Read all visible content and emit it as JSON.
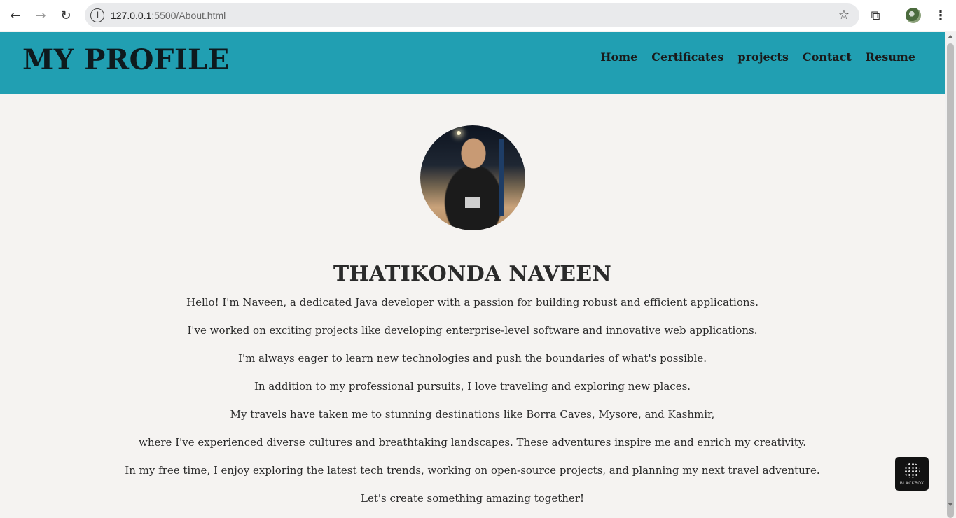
{
  "browser": {
    "url_host": "127.0.0.1",
    "url_path": ":5500/About.html",
    "back_icon": "arrow-left-icon",
    "forward_icon": "arrow-right-icon",
    "reload_icon": "reload-icon",
    "info_icon": "info-icon",
    "bookmark_icon": "star-icon",
    "extensions_icon": "puzzle-icon",
    "menu_icon": "kebab-menu-icon"
  },
  "header": {
    "title": "MY PROFILE",
    "nav": [
      "Home",
      "Certificates",
      "projects",
      "Contact",
      "Resume"
    ],
    "background_color": "#219fb2"
  },
  "profile": {
    "name": "THATIKONDA NAVEEN",
    "bio": [
      "Hello! I'm Naveen, a dedicated Java developer with a passion for building robust and efficient applications.",
      "I've worked on exciting projects like developing enterprise-level software and innovative web applications.",
      "I'm always eager to learn new technologies and push the boundaries of what's possible.",
      "In addition to my professional pursuits, I love traveling and exploring new places.",
      "My travels have taken me to stunning destinations like Borra Caves, Mysore, and Kashmir,",
      "where I've experienced diverse cultures and breathtaking landscapes. These adventures inspire me and enrich my creativity.",
      "In my free time, I enjoy exploring the latest tech trends, working on open-source projects, and planning my next travel adventure.",
      "Let's create something amazing together!"
    ]
  },
  "widget": {
    "label": "BLACKBOX"
  }
}
